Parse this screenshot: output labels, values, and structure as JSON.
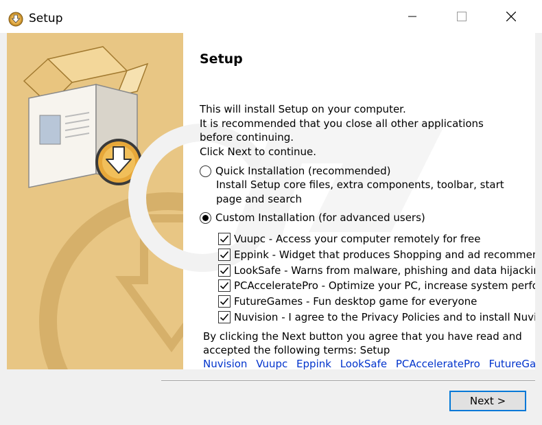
{
  "window": {
    "title": "Setup",
    "controls": {
      "minimize": "minimize-icon",
      "maximize": "maximize-icon",
      "close": "close-icon"
    }
  },
  "page": {
    "heading": "Setup",
    "intro_lines": [
      "This will install Setup on your computer.",
      "It is recommended that you close all other applications",
      "before continuing.",
      "Click Next to continue."
    ],
    "quick_install": {
      "label": "Quick Installation (recommended)",
      "desc_lines": [
        "Install Setup core files, extra components, toolbar, start",
        "page and search"
      ],
      "selected": false
    },
    "custom_install": {
      "label": "Custom Installation (for advanced users)",
      "selected": true
    },
    "offers": [
      {
        "text": "Vuupc - Access your computer remotely for free",
        "checked": true
      },
      {
        "text": "Eppink - Widget that produces Shopping and ad recommendations",
        "checked": true
      },
      {
        "text": "LookSafe - Warns from malware, phishing and data hijacking",
        "checked": true
      },
      {
        "text": "PCAcceleratePro - Optimize your PC, increase system performance",
        "checked": true
      },
      {
        "text": "FutureGames - Fun desktop game for everyone",
        "checked": true
      },
      {
        "text": "Nuvision - I agree to the Privacy Policies and to install Nuvision",
        "checked": true
      }
    ],
    "terms_lines": [
      "By clicking the Next button you agree that you have read and",
      "accepted the following terms: Setup"
    ],
    "term_links": [
      "Nuvision",
      "Vuupc",
      "Eppink",
      "LookSafe",
      "PCAcceleratePro",
      "FutureGames"
    ]
  },
  "footer": {
    "next_label": "Next >"
  },
  "colors": {
    "side_panel": "#e8c684",
    "accent": "#0078d7",
    "link": "#0033cc"
  }
}
